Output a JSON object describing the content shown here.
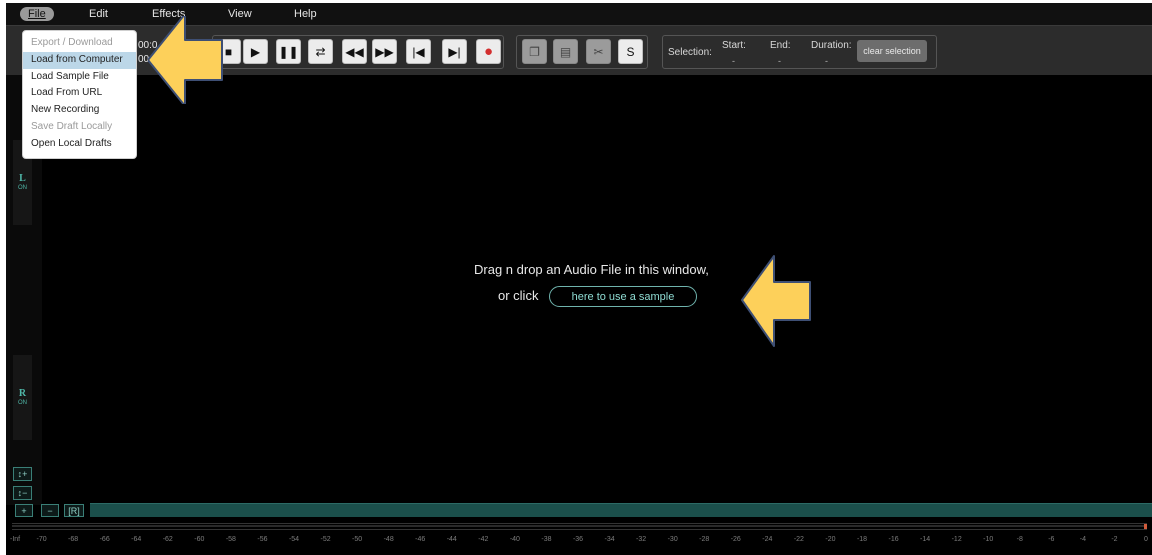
{
  "menubar": {
    "items": [
      {
        "label": "File",
        "active": true
      },
      {
        "label": "Edit"
      },
      {
        "label": "Effects"
      },
      {
        "label": "View"
      },
      {
        "label": "Help"
      }
    ]
  },
  "file_menu": {
    "items": [
      {
        "label": "Export / Download",
        "state": "disabled"
      },
      {
        "label": "Load from Computer",
        "state": "highlighted"
      },
      {
        "label": "Load Sample File"
      },
      {
        "label": "Load From URL"
      },
      {
        "label": "New Recording"
      },
      {
        "label": "Save Draft Locally",
        "state": "disabled"
      },
      {
        "label": "Open Local Drafts"
      }
    ]
  },
  "toolbar": {
    "time_top": "00:0",
    "time_bottom": "00:",
    "transport": [
      {
        "icon": "stop-icon",
        "symbol": "■"
      },
      {
        "icon": "play-icon",
        "symbol": "▶"
      },
      {
        "icon": "pause-icon",
        "symbol": "❚❚"
      },
      {
        "icon": "loop-icon",
        "symbol": "⇄"
      },
      {
        "icon": "rewind-icon",
        "symbol": "◀◀"
      },
      {
        "icon": "fast-forward-icon",
        "symbol": "▶▶"
      },
      {
        "icon": "skip-start-icon",
        "symbol": "|◀"
      },
      {
        "icon": "skip-end-icon",
        "symbol": "▶|"
      },
      {
        "icon": "record-icon",
        "symbol": "●"
      }
    ],
    "edit_buttons": [
      {
        "icon": "copy-icon",
        "symbol": "❐",
        "disabled": true
      },
      {
        "icon": "paste-icon",
        "symbol": "▤",
        "disabled": true
      },
      {
        "icon": "cut-icon",
        "symbol": "✂",
        "disabled": true
      },
      {
        "icon": "silence-icon",
        "symbol": "S",
        "disabled": false
      }
    ],
    "selection": {
      "label": "Selection:",
      "start_label": "Start:",
      "end_label": "End:",
      "duration_label": "Duration:",
      "start_value": "-",
      "end_value": "-",
      "duration_value": "-",
      "clear_label": "clear selection"
    }
  },
  "channels": {
    "left": {
      "letter": "L",
      "state": "ON"
    },
    "right": {
      "letter": "R",
      "state": "ON"
    }
  },
  "zoom": {
    "in_label": "↕+",
    "out_label": "↕−"
  },
  "main": {
    "drop_text": "Drag n drop an Audio File in this window,",
    "or_click": "or click",
    "sample_link": "here to use a sample"
  },
  "bottom": {
    "zoom_in": "+",
    "zoom_out": "−",
    "reset": "[R]"
  },
  "db_scale": [
    "-Inf",
    "-70",
    "-68",
    "-66",
    "-64",
    "-62",
    "-60",
    "-58",
    "-56",
    "-54",
    "-52",
    "-50",
    "-48",
    "-46",
    "-44",
    "-42",
    "-40",
    "-38",
    "-36",
    "-34",
    "-32",
    "-30",
    "-28",
    "-26",
    "-24",
    "-22",
    "-20",
    "-18",
    "-16",
    "-14",
    "-12",
    "-10",
    "-8",
    "-6",
    "-4",
    "-2",
    "0"
  ],
  "colors": {
    "accent": "#4fb7a8",
    "arrow": "#fdd05a",
    "record": "#d32f2f"
  }
}
